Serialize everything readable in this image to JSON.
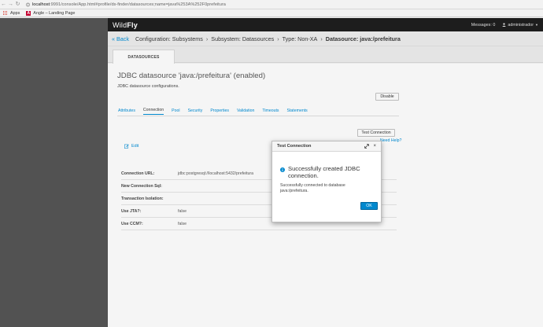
{
  "browser": {
    "url_host": "localhost",
    "url_path": ":9991/console/App.html#profile/ds-finder/datasources;name=java%253A%252F0prefeitura",
    "bookmarks": [
      {
        "label": "Apps"
      },
      {
        "label": "Angle – Landing Page"
      }
    ],
    "angle_letter": "A"
  },
  "app": {
    "logo_light": "Wild",
    "logo_bold": "Fly",
    "messages": "Messages: 0",
    "user": "administrador"
  },
  "breadcrumb": {
    "back": "« Back",
    "items": [
      "Configuration: Subsystems",
      "Subsystem: Datasources",
      "Type: Non-XA"
    ],
    "separator": "›",
    "current": "Datasource: java:/prefeitura"
  },
  "main_tab": "DATASOURCES",
  "datasource": {
    "title": "JDBC datasource 'java:/prefeitura' (enabled)",
    "description": "JDBC datasource configurations.",
    "disable_label": "Disable"
  },
  "subtabs": [
    {
      "label": "Attributes",
      "active": false
    },
    {
      "label": "Connection",
      "active": true
    },
    {
      "label": "Pool",
      "active": false
    },
    {
      "label": "Security",
      "active": false
    },
    {
      "label": "Properties",
      "active": false
    },
    {
      "label": "Validation",
      "active": false
    },
    {
      "label": "Timeouts",
      "active": false
    },
    {
      "label": "Statements",
      "active": false
    }
  ],
  "connection": {
    "test_connection_label": "Test Connection",
    "help_label": "Need Help?",
    "edit_label": "Edit",
    "attributes": [
      {
        "label": "Connection URL:",
        "value": "jdbc:postgresql://localhost:5432/prefeitura"
      },
      {
        "label": "New Connection Sql:",
        "value": ""
      },
      {
        "label": "Transaction Isolation:",
        "value": ""
      },
      {
        "label": "Use JTA?:",
        "value": "false"
      },
      {
        "label": "Use CCM?:",
        "value": "false"
      }
    ]
  },
  "dialog": {
    "title": "Test Connection",
    "message": "Successfully created JDBC connection.",
    "detail": "Successfully connected to database java:/prefeitura.",
    "ok_label": "OK",
    "close_glyph": "×"
  },
  "colors": {
    "accent": "#0088ce",
    "topbar": "#1d1d1d",
    "overlay": "#525252"
  }
}
